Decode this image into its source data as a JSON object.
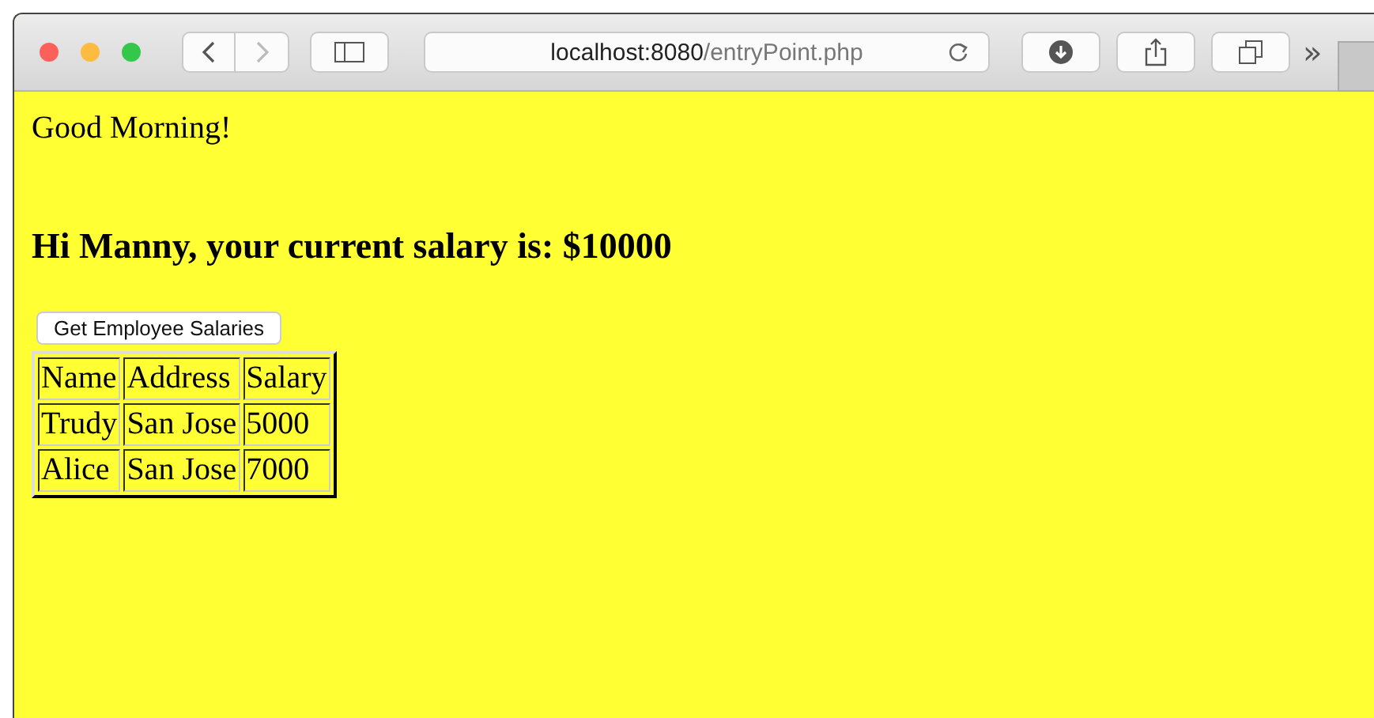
{
  "browser": {
    "url_host": "localhost:8080",
    "url_path": "/entryPoint.php",
    "more": "»"
  },
  "page": {
    "greeting": "Good Morning!",
    "heading": "Hi Manny, your current salary is: $10000",
    "button": "Get Employee Salaries",
    "table": {
      "rows": [
        [
          "Name",
          "Address",
          "Salary"
        ],
        [
          "Trudy",
          "San Jose",
          "5000"
        ],
        [
          "Alice",
          "San Jose",
          "7000"
        ]
      ]
    }
  }
}
